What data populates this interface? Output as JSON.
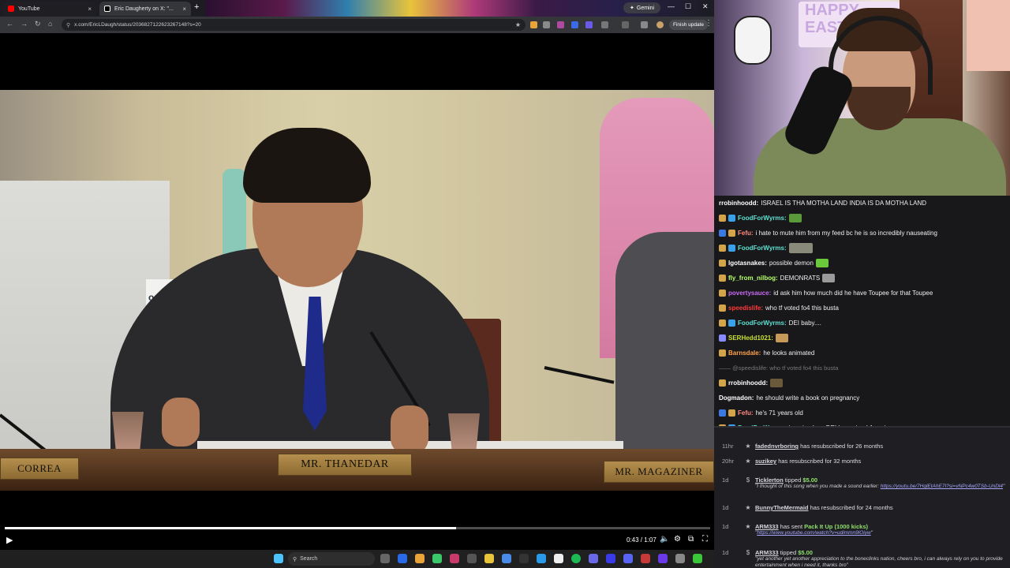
{
  "browser": {
    "tabs": [
      {
        "label": "YouTube",
        "close": "×",
        "active": false,
        "favicon_color": "#ff0000"
      },
      {
        "label": "Eric Daugherty on X: \"...",
        "close": "×",
        "active": true,
        "favicon_color": "#ffffff"
      }
    ],
    "new_tab": "+",
    "gemini_label": "Gemini",
    "window_controls": {
      "minimize": "—",
      "maximize": "☐",
      "close": "✕"
    },
    "nav": {
      "back": "←",
      "forward": "→",
      "reload": "↻",
      "home": "⌂"
    },
    "url": "x.com/EricLDaugh/status/2036827122623267148?s=20",
    "bookmark_icon": "★",
    "finish_update": "Finish update",
    "menu_icon": "⋮"
  },
  "video": {
    "nameplates": {
      "left": "CORREA",
      "center": "MR. THANEDAR",
      "right": "MR. MAGAZINER"
    },
    "sign_text": "op Ai",
    "time": "0:43 / 1:07",
    "progress": 0.64,
    "controls": {
      "play": "▶",
      "volume": "🔈",
      "settings": "⚙",
      "miniplayer": "⧉",
      "fullscreen": "⛶"
    }
  },
  "taskbar": {
    "search_placeholder": "Search",
    "start_icon_color": "#4cc2ff"
  },
  "webcam": {
    "poster_text": "HAPPY EASTER"
  },
  "chat": {
    "messages": [
      {
        "user": "rrobinhoodd",
        "color": "#ffffff",
        "text": "ISRAEL IS THA MOTHA LAND INDIA IS DA MOTHA LAND",
        "badges": [],
        "emote": ""
      },
      {
        "user": "FoodForWyrms",
        "color": "#5ce0d0",
        "text": "",
        "badges": [
          "#d4a44a",
          "#3aa0e8"
        ],
        "emote": "frog"
      },
      {
        "user": "Fefu",
        "color": "#ff8a80",
        "text": "i hate to mute him from my feed bc he is so incredibly nauseating",
        "badges": [
          "#3a7ae0",
          "#d4a44a"
        ],
        "emote": ""
      },
      {
        "user": "FoodForWyrms",
        "color": "#5ce0d0",
        "text": "",
        "badges": [
          "#d4a44a",
          "#3aa0e8"
        ],
        "emote": "wide"
      },
      {
        "user": "lgotasnakes",
        "color": "#ffffff",
        "text": "possible demon",
        "badges": [
          "#d4a44a"
        ],
        "emote": "frog2"
      },
      {
        "user": "fly_from_nilbog",
        "color": "#b6ff6a",
        "text": "DEMONRATS",
        "badges": [
          "#d4a44a"
        ],
        "emote": "cat"
      },
      {
        "user": "povertysauce",
        "color": "#c86af0",
        "text": "id ask him how much did he have Toupee for that Toupee",
        "badges": [
          "#d4a44a"
        ],
        "emote": ""
      },
      {
        "user": "speedislife",
        "color": "#ff3a3a",
        "text": "who tf voted fo4 this busta",
        "badges": [
          "#d4a44a"
        ],
        "emote": ""
      },
      {
        "user": "FoodForWyrms",
        "color": "#5ce0d0",
        "text": "DEI baby....",
        "badges": [
          "#d4a44a",
          "#3aa0e8"
        ],
        "emote": ""
      },
      {
        "user": "SERHedd1021",
        "color": "#c8e030",
        "text": "",
        "badges": [
          "#8a8aff"
        ],
        "emote": "dog"
      },
      {
        "user": "Barnsdale",
        "color": "#ffa34a",
        "text": "he looks animated",
        "badges": [
          "#d4a44a"
        ],
        "emote": ""
      },
      {
        "user": "",
        "color": "#777777",
        "text": "@speedislife: who tf voted fo4 this busta",
        "badges": [],
        "emote": "",
        "reply": true
      },
      {
        "user": "rrobinhoodd",
        "color": "#ffffff",
        "text": "",
        "badges": [
          "#d4a44a"
        ],
        "emote": "pepe"
      },
      {
        "user": "Dogmadon",
        "color": "#ffffff",
        "text": "he should write a book on pregnancy",
        "badges": [],
        "emote": ""
      },
      {
        "user": "Fefu",
        "color": "#ff8a80",
        "text": "he's 71 years old",
        "badges": [
          "#3a7ae0",
          "#d4a44a"
        ],
        "emote": ""
      },
      {
        "user": "FoodForWyrms",
        "color": "#5ce0d0",
        "text": "imagine how DEI has ruined America...",
        "badges": [
          "#d4a44a",
          "#3aa0e8"
        ],
        "emote": ""
      }
    ]
  },
  "events": [
    {
      "time": "11hr",
      "icon": "★",
      "name": "fadednvrboring",
      "text": " has resubscribed for 26 months"
    },
    {
      "time": "20hr",
      "icon": "★",
      "name": "suzikey",
      "text": " has resubscribed for 32 months"
    },
    {
      "time": "1d",
      "icon": "$",
      "name": "Ticklerton",
      "text": " tipped ",
      "amount": "$5.00",
      "msg_prefix": "\"I thought of this song when you made a sound earlier: ",
      "msg_link": "https://youtu.be/7HqlEtAhE7I?si=vNPc4w0TSb-UnDl4",
      "msg_suffix": "\""
    },
    {
      "time": "1d",
      "icon": "★",
      "name": "BunnyTheMermaid",
      "text": " has resubscribed for 24 months"
    },
    {
      "time": "1d",
      "icon": "★",
      "name": "ARM333",
      "text": " has sent ",
      "amount": "Pack It Up (1000 kicks)",
      "msg_prefix": "\"",
      "msg_link": "https://www.youtube.com/watch?v=udimmn9lOiyw",
      "msg_suffix": "\""
    },
    {
      "time": "1d",
      "icon": "$",
      "name": "ARM333",
      "text": " tipped ",
      "amount": "$5.00",
      "msg_prefix": "\"yet another yet another appreciation to the boneclinks nation, cheers bro, i can always rely on you to provide entertainment when i need it, thanks bro\"",
      "msg_link": "",
      "msg_suffix": ""
    }
  ]
}
